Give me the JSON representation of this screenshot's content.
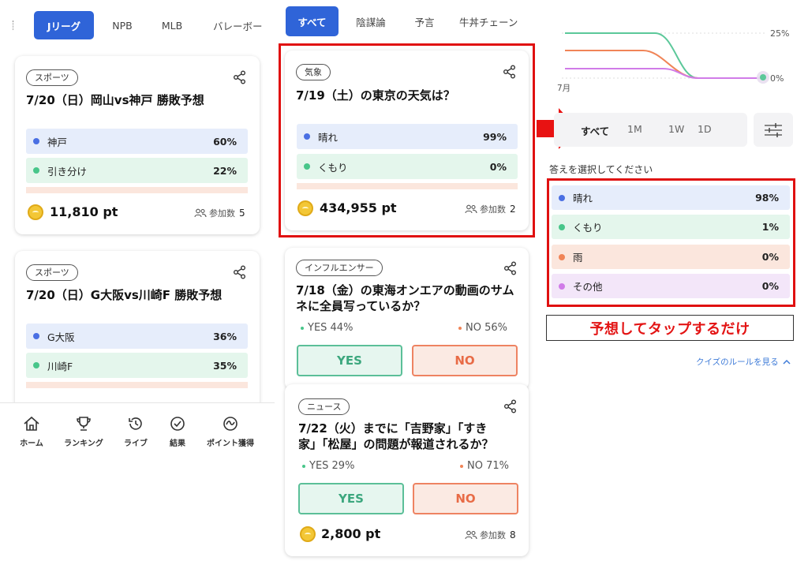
{
  "panel1": {
    "tabs": [
      {
        "label": "Jリーグ",
        "active": true
      },
      {
        "label": "NPB",
        "active": false
      },
      {
        "label": "MLB",
        "active": false
      },
      {
        "label": "バレーボー",
        "active": false
      }
    ],
    "cards": [
      {
        "tag": "スポーツ",
        "title": "7/20（日）岡山vs神戸 勝敗予想",
        "options": [
          {
            "label": "神戸",
            "pct": "60%"
          },
          {
            "label": "引き分け",
            "pct": "22%"
          }
        ],
        "points": "11,810 pt",
        "participants_label": "参加数",
        "participants": "5"
      },
      {
        "tag": "スポーツ",
        "title": "7/20（日）G大阪vs川崎F 勝敗予想",
        "options": [
          {
            "label": "G大阪",
            "pct": "36%"
          },
          {
            "label": "川崎F",
            "pct": "35%"
          }
        ]
      }
    ],
    "nav": [
      {
        "label": "ホーム",
        "icon": "home-icon"
      },
      {
        "label": "ランキング",
        "icon": "trophy-icon"
      },
      {
        "label": "ライブ",
        "icon": "history-icon"
      },
      {
        "label": "結果",
        "icon": "check-circle-icon"
      },
      {
        "label": "ポイント獲得",
        "icon": "point-icon"
      }
    ]
  },
  "panel2": {
    "tabs": [
      {
        "label": "すべて",
        "active": true
      },
      {
        "label": "陰謀論",
        "active": false
      },
      {
        "label": "予言",
        "active": false
      },
      {
        "label": "牛丼チェーン",
        "active": false
      }
    ],
    "weather_card": {
      "tag": "気象",
      "title": "7/19（土）の東京の天気は？",
      "options": [
        {
          "label": "晴れ",
          "pct": "99%"
        },
        {
          "label": "くもり",
          "pct": "0%"
        }
      ],
      "points": "434,955 pt",
      "participants_label": "参加数",
      "participants": "2"
    },
    "influencer_card": {
      "tag": "インフルエンサー",
      "title_line1": "7/18（金）の東海オンエアの動画のサム",
      "title_line2": "ネに全員写っているか？",
      "yes_stat": "YES 44%",
      "no_stat": "NO 56%",
      "yes_button": "YES",
      "no_button": "NO"
    },
    "news_card": {
      "tag": "ニュース",
      "title_line1": "7/22（火）までに「吉野家」「すき",
      "title_line2": "家」「松屋」の問題が報道されるか？",
      "yes_stat": "YES 29%",
      "no_stat": "NO 71%",
      "yes_button": "YES",
      "no_button": "NO",
      "points": "2,800 pt",
      "participants_label": "参加数",
      "participants": "8"
    }
  },
  "panel3": {
    "chart": {
      "y_ticks": [
        "25%",
        "0%"
      ],
      "x_label": "7月",
      "series_colors": [
        "#5cc89a",
        "#f08457",
        "#d07ce8"
      ]
    },
    "ranges": [
      {
        "label": "すべて",
        "selected": true
      },
      {
        "label": "1M",
        "selected": false
      },
      {
        "label": "1W",
        "selected": false
      },
      {
        "label": "1D",
        "selected": false
      }
    ],
    "prompt": "答えを選択してください",
    "options": [
      {
        "label": "晴れ",
        "pct": "98%"
      },
      {
        "label": "くもり",
        "pct": "1%"
      },
      {
        "label": "雨",
        "pct": "0%"
      },
      {
        "label": "その他",
        "pct": "0%"
      }
    ],
    "banner": "予想してタップするだけ",
    "rules_link": "クイズのルールを見る"
  },
  "colors": {
    "accent": "#2f64d8",
    "highlight": "#e01010",
    "yes": "#3ca77e",
    "no": "#e86b46"
  }
}
